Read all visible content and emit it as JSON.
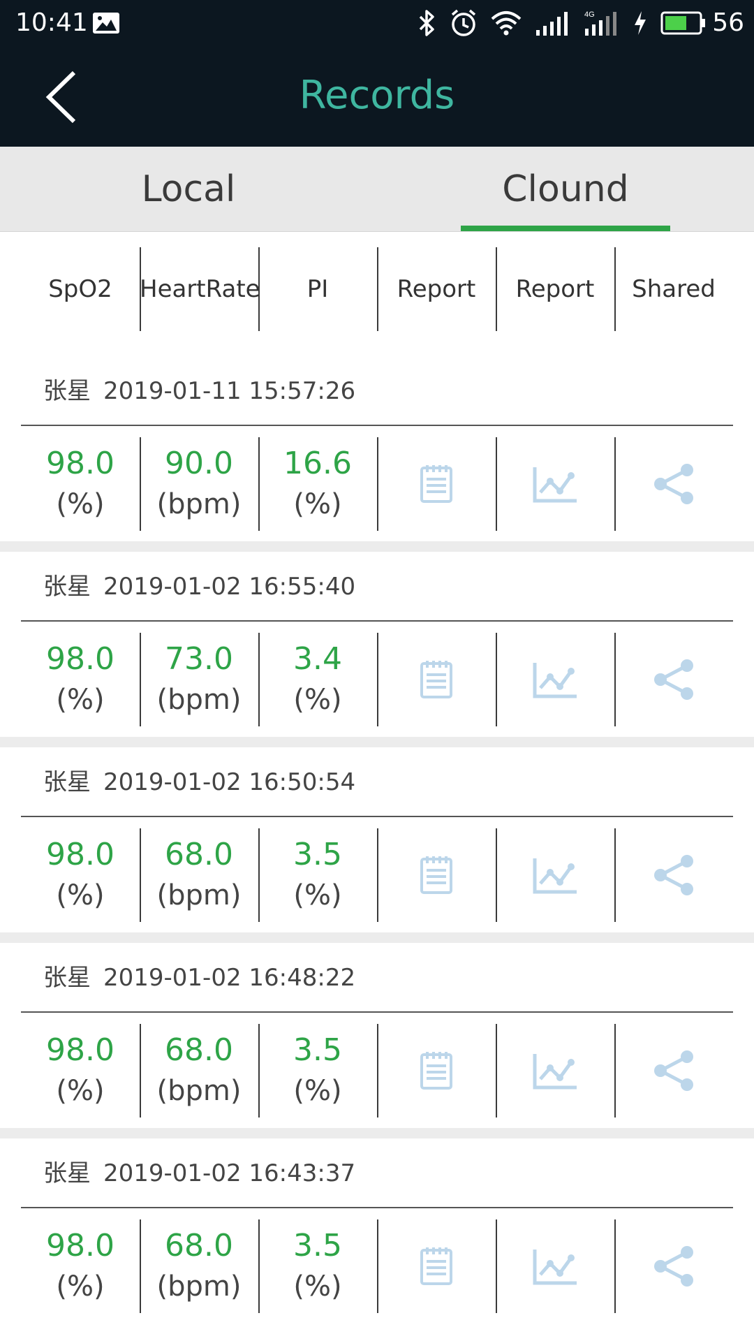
{
  "status_bar": {
    "time": "10:41",
    "battery_level": "56",
    "icons": [
      "image-icon",
      "bluetooth-icon",
      "alarm-icon",
      "wifi-icon",
      "signal-icon",
      "4g-signal-icon",
      "charging-icon",
      "battery-icon"
    ]
  },
  "toolbar": {
    "title": "Records",
    "back_icon": "chevron-left-icon"
  },
  "tabs": [
    {
      "label": "Local",
      "selected": false
    },
    {
      "label": "Clound",
      "selected": true
    }
  ],
  "columns": [
    "SpO2",
    "HeartRate",
    "PI",
    "Report",
    "Report",
    "Shared"
  ],
  "records": [
    {
      "name": "张星",
      "datetime": "2019-01-11 15:57:26",
      "spo2": "98.0",
      "spo2_unit": "(%)",
      "hr": "90.0",
      "hr_unit": "(bpm)",
      "pi": "16.6",
      "pi_unit": "(%)"
    },
    {
      "name": "张星",
      "datetime": "2019-01-02 16:55:40",
      "spo2": "98.0",
      "spo2_unit": "(%)",
      "hr": "73.0",
      "hr_unit": "(bpm)",
      "pi": "3.4",
      "pi_unit": "(%)"
    },
    {
      "name": "张星",
      "datetime": "2019-01-02 16:50:54",
      "spo2": "98.0",
      "spo2_unit": "(%)",
      "hr": "68.0",
      "hr_unit": "(bpm)",
      "pi": "3.5",
      "pi_unit": "(%)"
    },
    {
      "name": "张星",
      "datetime": "2019-01-02 16:48:22",
      "spo2": "98.0",
      "spo2_unit": "(%)",
      "hr": "68.0",
      "hr_unit": "(bpm)",
      "pi": "3.5",
      "pi_unit": "(%)"
    },
    {
      "name": "张星",
      "datetime": "2019-01-02 16:43:37",
      "spo2": "98.0",
      "spo2_unit": "(%)",
      "hr": "68.0",
      "hr_unit": "(bpm)",
      "pi": "3.5",
      "pi_unit": "(%)"
    }
  ],
  "colors": {
    "header_bg": "#0c1720",
    "title": "#3fb6a0",
    "accent_green": "#2ea447",
    "icon_blue": "#bcd6ea"
  },
  "row_icons": [
    "report-icon",
    "chart-icon",
    "share-icon"
  ]
}
